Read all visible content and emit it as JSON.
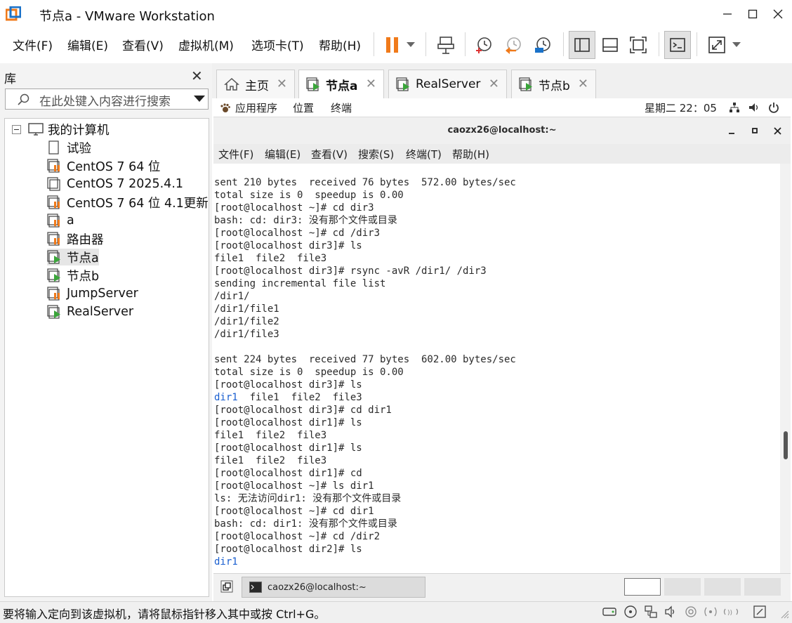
{
  "window": {
    "title": "节点a - VMware Workstation"
  },
  "menu": [
    "文件(F)",
    "编辑(E)",
    "查看(V)",
    "虚拟机(M)",
    "选项卡(T)",
    "帮助(H)"
  ],
  "library": {
    "title": "库",
    "search_placeholder": "在此处键入内容进行搜索",
    "root": "我的计算机",
    "items": [
      "试验",
      "CentOS 7 64 位",
      "CentOS 7 2025.4.1",
      "CentOS 7 64 位 4.1更新",
      "a",
      "路由器",
      "节点a",
      "节点b",
      "JumpServer",
      "RealServer"
    ]
  },
  "tabs": [
    {
      "label": "主页",
      "icon": "home-icon"
    },
    {
      "label": "节点a",
      "icon": "vm-running-icon"
    },
    {
      "label": "RealServer",
      "icon": "vm-running-icon"
    },
    {
      "label": "节点b",
      "icon": "vm-running-icon"
    }
  ],
  "gnome": {
    "apps": "应用程序",
    "places": "位置",
    "terminal": "终端",
    "clock": "星期二 22：05"
  },
  "terminal": {
    "title": "caozx26@localhost:~",
    "menu": [
      "文件(F)",
      "编辑(E)",
      "查看(V)",
      "搜索(S)",
      "终端(T)",
      "帮助(H)"
    ],
    "lines": [
      "sent 210 bytes  received 76 bytes  572.00 bytes/sec",
      "total size is 0  speedup is 0.00",
      "[root@localhost ~]# cd dir3",
      "bash: cd: dir3: 没有那个文件或目录",
      "[root@localhost ~]# cd /dir3",
      "[root@localhost dir3]# ls",
      "file1  file2  file3",
      "[root@localhost dir3]# rsync -avR /dir1/ /dir3",
      "sending incremental file list",
      "/dir1/",
      "/dir1/file1",
      "/dir1/file2",
      "/dir1/file3",
      "",
      "sent 224 bytes  received 77 bytes  602.00 bytes/sec",
      "total size is 0  speedup is 0.00",
      "[root@localhost dir3]# ls",
      "dir1  file1  file2  file3",
      "[root@localhost dir3]# cd dir1",
      "[root@localhost dir1]# ls",
      "file1  file2  file3",
      "[root@localhost dir1]# ls",
      "file1  file2  file3",
      "[root@localhost dir1]# cd",
      "[root@localhost ~]# ls dir1",
      "ls: 无法访问dir1: 没有那个文件或目录",
      "[root@localhost ~]# cd dir1",
      "bash: cd: dir1: 没有那个文件或目录",
      "[root@localhost ~]# cd /dir2",
      "[root@localhost dir2]# ls",
      "dir1"
    ],
    "dir_color": "#1a5fd0"
  },
  "taskbar": {
    "task": "caozx26@localhost:~"
  },
  "statusbar": {
    "text": "要将输入定向到该虚拟机，请将鼠标指针移入其中或按 Ctrl+G。"
  },
  "colors": {
    "pause": "#f07a1a",
    "accent": "#1a5fd0",
    "vm_green": "#3aa53a"
  }
}
